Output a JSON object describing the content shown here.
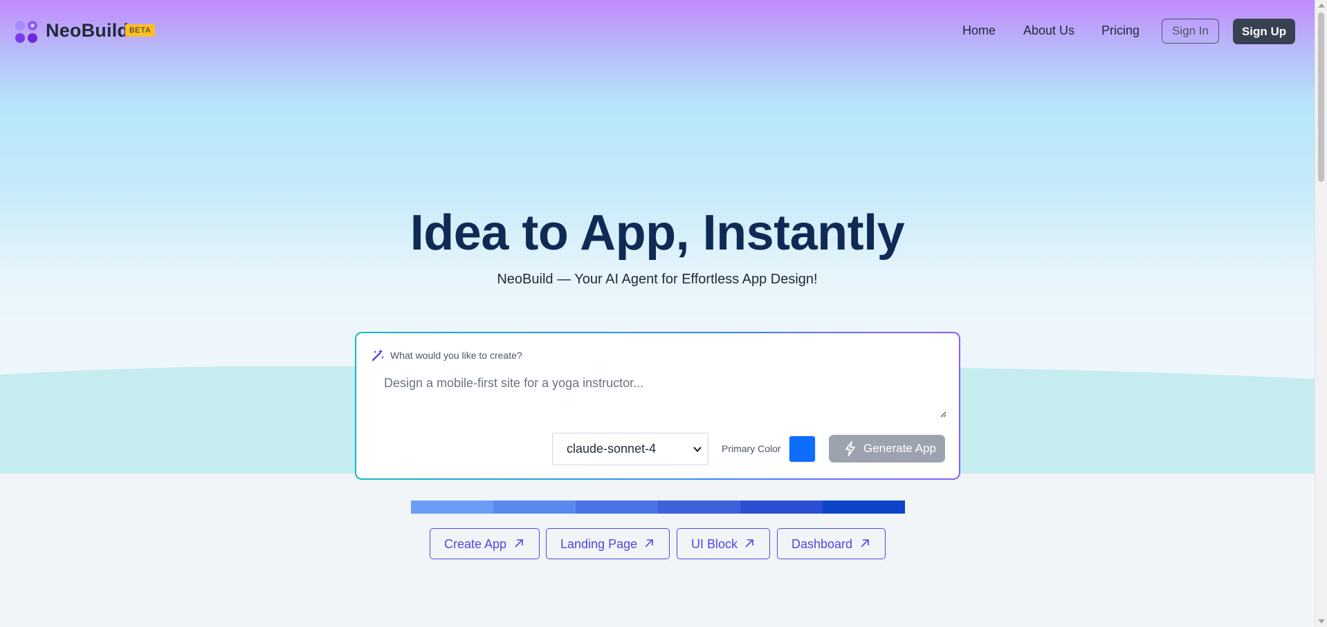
{
  "header": {
    "brand": "NeoBuild",
    "badge": "BETA",
    "nav": [
      {
        "label": "Home"
      },
      {
        "label": "About Us"
      },
      {
        "label": "Pricing"
      }
    ],
    "sign_in_label": "Sign In",
    "sign_up_label": "Sign Up"
  },
  "hero": {
    "title": "Idea to App, Instantly",
    "subtitle": "NeoBuild — Your AI Agent for Effortless App Design!"
  },
  "prompt": {
    "label": "What would you like to create?",
    "placeholder": "Design a mobile-first site for a yoga instructor...",
    "model_value": "claude-sonnet-4",
    "primary_color_label": "Primary Color",
    "primary_color": "#0d6efd",
    "generate_label": "Generate App"
  },
  "palette": [
    "#6b9cf8",
    "#5a88ef",
    "#4a74e6",
    "#3c62db",
    "#2b4fd3",
    "#0b44c8"
  ],
  "quick_links": [
    {
      "label": "Create App"
    },
    {
      "label": "Landing Page"
    },
    {
      "label": "UI Block"
    },
    {
      "label": "Dashboard"
    }
  ],
  "colors": {
    "headline": "#0f2a55",
    "accent": "#4f46e5",
    "badge": "#fbbf24",
    "sign_up_bg": "#374151"
  }
}
